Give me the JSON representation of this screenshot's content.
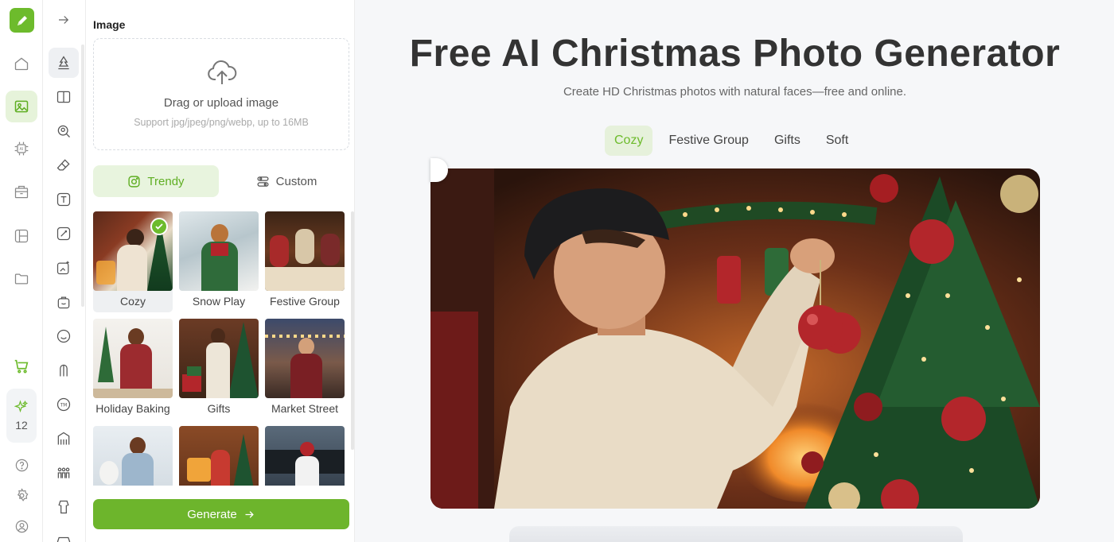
{
  "rail": {
    "credits": "12"
  },
  "panel": {
    "section_title": "Image",
    "upload": {
      "title": "Drag or upload image",
      "hint": "Support jpg/jpeg/png/webp, up to 16MB"
    },
    "modes": [
      {
        "label": "Trendy",
        "icon": "instagram-icon",
        "selected": true
      },
      {
        "label": "Custom",
        "icon": "sliders-icon",
        "selected": false
      }
    ],
    "styles": [
      {
        "label": "Cozy",
        "selected": true
      },
      {
        "label": "Snow Play"
      },
      {
        "label": "Festive Group"
      },
      {
        "label": "Holiday Baking"
      },
      {
        "label": "Gifts"
      },
      {
        "label": "Market Street"
      },
      {
        "label": ""
      },
      {
        "label": ""
      },
      {
        "label": ""
      }
    ],
    "generate_label": "Generate"
  },
  "main": {
    "title": "Free AI Christmas Photo Generator",
    "subtitle": "Create HD Christmas photos with natural faces—free and online.",
    "tabs": [
      {
        "label": "Cozy",
        "selected": true
      },
      {
        "label": "Festive Group"
      },
      {
        "label": "Gifts"
      },
      {
        "label": "Soft"
      }
    ]
  },
  "colors": {
    "accent": "#6dbb2c",
    "accent_soft": "#e6f1db"
  }
}
